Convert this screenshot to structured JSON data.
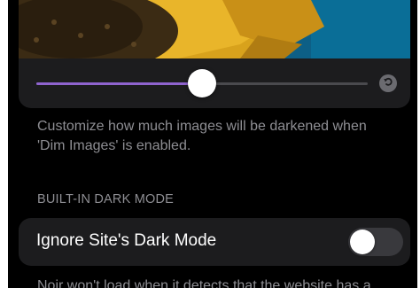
{
  "dim_images": {
    "slider_value": 0.5,
    "footnote_line1": "Customize how much images will be darkened when",
    "footnote_line2": "'Dim Images' is enabled."
  },
  "built_in_dark_mode": {
    "section_header": "BUILT-IN DARK MODE",
    "ignore_label": "Ignore Site's Dark Mode",
    "ignore_enabled": false,
    "footnote_partial": "Noir won't load when it detects that the website has a"
  },
  "colors": {
    "accent": "#8f64cf",
    "background": "#000000",
    "card": "#1c1c1e",
    "secondary_text": "#8e8e93"
  },
  "icons": {
    "reset": "reset-arrow-icon"
  }
}
